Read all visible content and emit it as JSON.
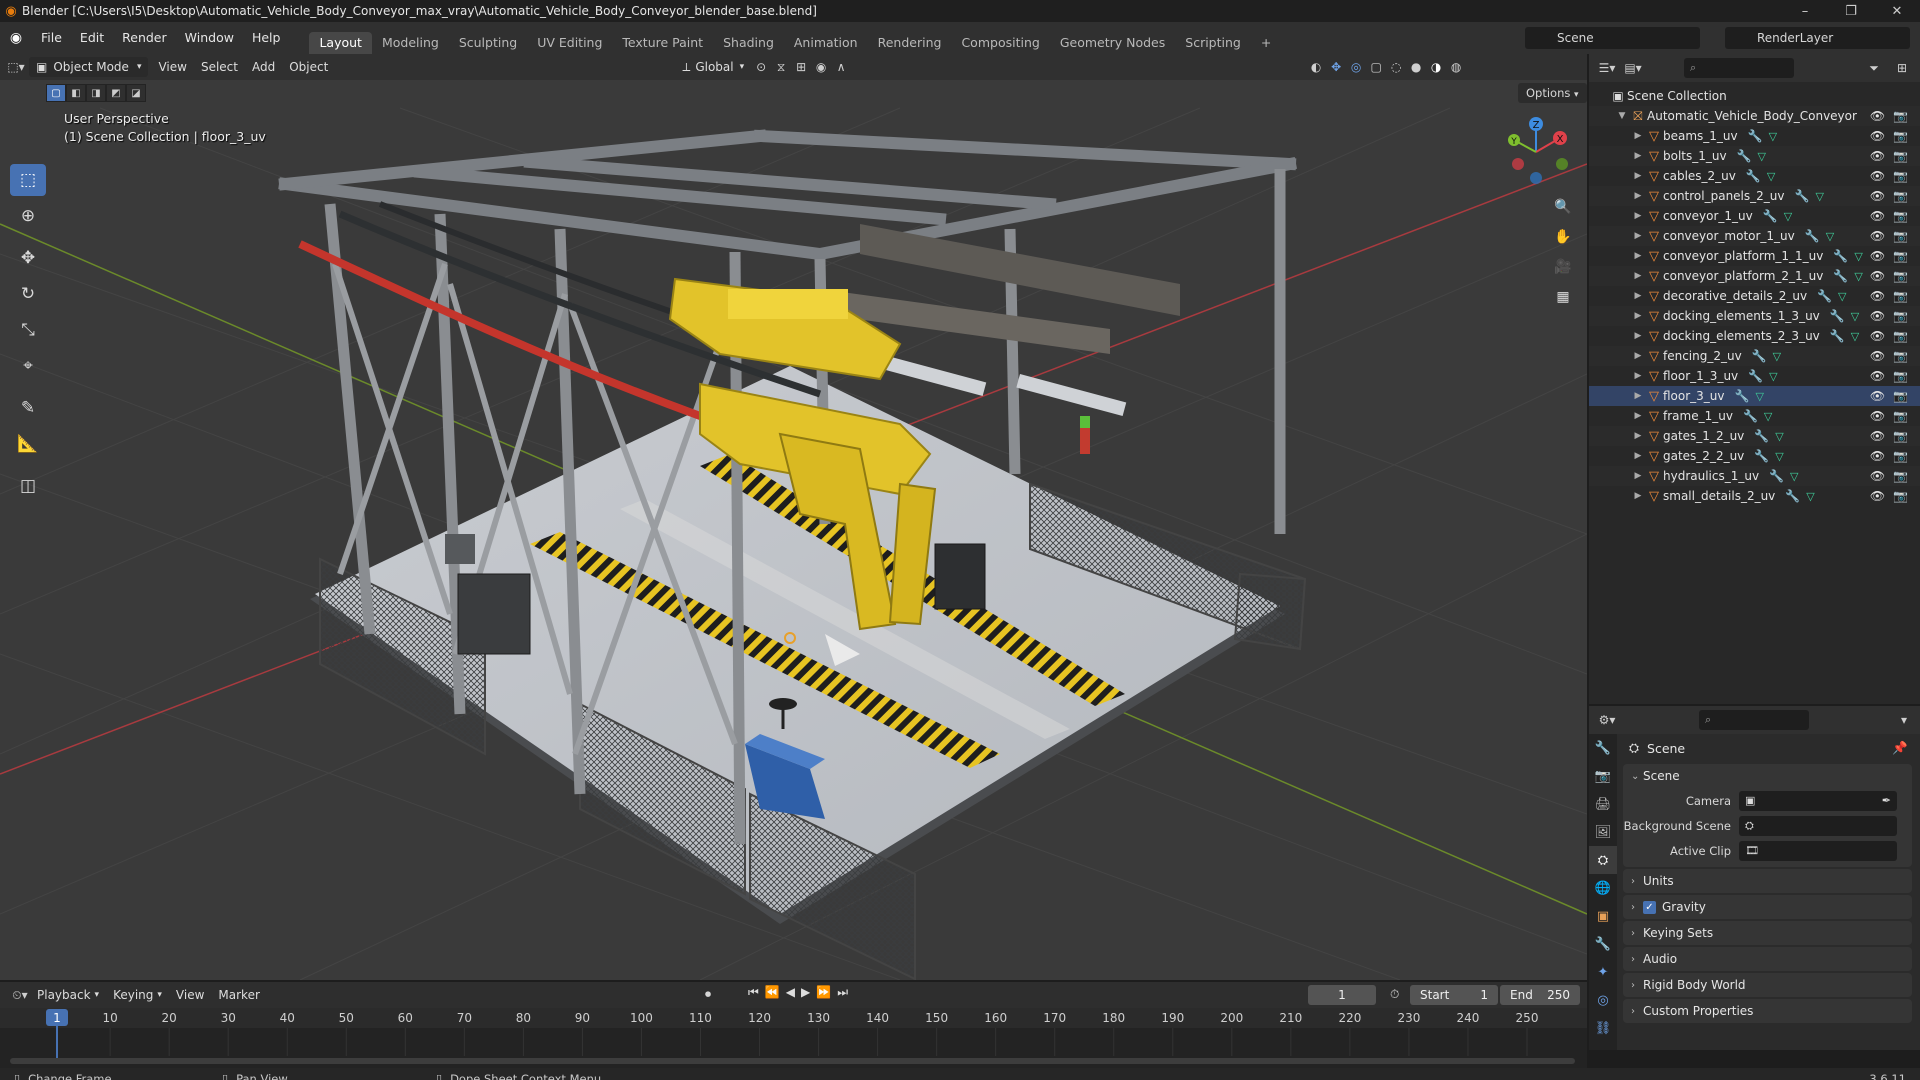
{
  "window": {
    "title": "Blender [C:\\Users\\I5\\Desktop\\Automatic_Vehicle_Body_Conveyor_max_vray\\Automatic_Vehicle_Body_Conveyor_blender_base.blend]",
    "controls": [
      "–",
      "❐",
      "✕"
    ]
  },
  "menu": [
    "File",
    "Edit",
    "Render",
    "Window",
    "Help"
  ],
  "workspaces": [
    {
      "label": "Layout",
      "active": true
    },
    {
      "label": "Modeling"
    },
    {
      "label": "Sculpting"
    },
    {
      "label": "UV Editing"
    },
    {
      "label": "Texture Paint"
    },
    {
      "label": "Shading"
    },
    {
      "label": "Animation"
    },
    {
      "label": "Rendering"
    },
    {
      "label": "Compositing"
    },
    {
      "label": "Geometry Nodes"
    },
    {
      "label": "Scripting"
    },
    {
      "label": "+"
    }
  ],
  "scene_selector": "Scene",
  "view_layer": "RenderLayer",
  "viewport_header": {
    "mode": "Object Mode",
    "menus": [
      "View",
      "Select",
      "Add",
      "Object"
    ],
    "transform_orientation": "Global",
    "options": "Options"
  },
  "viewport_info": {
    "line1": "User Perspective",
    "line2": "(1) Scene Collection | floor_3_uv"
  },
  "gizmo": {
    "x": "X",
    "y": "Y",
    "z": "Z"
  },
  "outliner": {
    "root": "Scene Collection",
    "collection": "Automatic_Vehicle_Body_Conveyor",
    "items": [
      "beams_1_uv",
      "bolts_1_uv",
      "cables_2_uv",
      "control_panels_2_uv",
      "conveyor_1_uv",
      "conveyor_motor_1_uv",
      "conveyor_platform_1_1_uv",
      "conveyor_platform_2_1_uv",
      "decorative_details_2_uv",
      "docking_elements_1_3_uv",
      "docking_elements_2_3_uv",
      "fencing_2_uv",
      "floor_1_3_uv",
      "floor_3_uv",
      "frame_1_uv",
      "gates_1_2_uv",
      "gates_2_2_uv",
      "hydraulics_1_uv",
      "small_details_2_uv"
    ]
  },
  "properties": {
    "context": "Scene",
    "panel_title": "Scene",
    "fields": [
      {
        "label": "Camera",
        "value": ""
      },
      {
        "label": "Background Scene",
        "value": ""
      },
      {
        "label": "Active Clip",
        "value": ""
      }
    ],
    "subpanels": [
      "Units",
      "Gravity",
      "Keying Sets",
      "Audio",
      "Rigid Body World",
      "Custom Properties"
    ]
  },
  "timeline": {
    "menus": [
      "Playback",
      "Keying",
      "View",
      "Marker"
    ],
    "current_frame": "1",
    "start_label": "Start",
    "start": "1",
    "end_label": "End",
    "end": "250",
    "ticks": [
      "1",
      "10",
      "20",
      "30",
      "40",
      "50",
      "60",
      "70",
      "80",
      "90",
      "100",
      "110",
      "120",
      "130",
      "140",
      "150",
      "160",
      "170",
      "180",
      "190",
      "200",
      "210",
      "220",
      "230",
      "240",
      "250"
    ]
  },
  "statusbar": {
    "left": "Change Frame",
    "middle": "Pan View",
    "right": "Dope Sheet Context Menu",
    "version": "3.6.11"
  },
  "colors": {
    "accent": "#4772b3",
    "mesh_icon": "#ee8a3a",
    "yellow_machine": "#e2c32a",
    "cable_red": "#c4352c",
    "axis_x": "#e0414a",
    "axis_y": "#7fbf2e",
    "axis_z": "#3d8ce0"
  }
}
